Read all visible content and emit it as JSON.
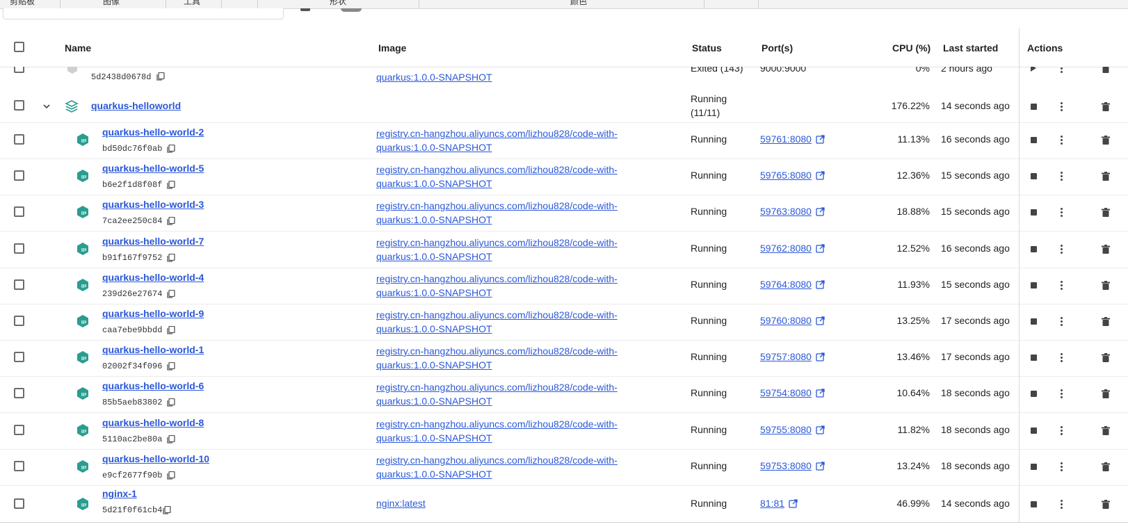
{
  "ribbon": {
    "sections": [
      "剪贴板",
      "图像",
      "工具",
      "形状",
      "颜色"
    ]
  },
  "table": {
    "columns": {
      "name": "Name",
      "image": "Image",
      "status": "Status",
      "ports": "Port(s)",
      "cpu": "CPU (%)",
      "last_started": "Last started",
      "actions": "Actions"
    },
    "partial_row": {
      "id": "5d2438d0678d",
      "image": "quarkus:1.0.0-SNAPSHOT",
      "status": "Exited (143)",
      "ports": "9000:9000",
      "cpu": "0%",
      "last_started": "2 hours ago"
    },
    "group": {
      "name": "quarkus-helloworld",
      "status_line1": "Running",
      "status_line2": "(11/11)",
      "cpu": "176.22%",
      "last_started": "14 seconds ago"
    },
    "containers": [
      {
        "name": "quarkus-hello-world-2",
        "id": "bd50dc76f0ab",
        "image_line1": "registry.cn-hangzhou.aliyuncs.com/lizhou828/code-with-",
        "image_line2": "quarkus:1.0.0-SNAPSHOT",
        "status": "Running",
        "ports": "59761:8080",
        "cpu": "11.13%",
        "last_started": "16 seconds ago"
      },
      {
        "name": "quarkus-hello-world-5",
        "id": "b6e2f1d8f08f",
        "image_line1": "registry.cn-hangzhou.aliyuncs.com/lizhou828/code-with-",
        "image_line2": "quarkus:1.0.0-SNAPSHOT",
        "status": "Running",
        "ports": "59765:8080",
        "cpu": "12.36%",
        "last_started": "15 seconds ago"
      },
      {
        "name": "quarkus-hello-world-3",
        "id": "7ca2ee250c84",
        "image_line1": "registry.cn-hangzhou.aliyuncs.com/lizhou828/code-with-",
        "image_line2": "quarkus:1.0.0-SNAPSHOT",
        "status": "Running",
        "ports": "59763:8080",
        "cpu": "18.88%",
        "last_started": "15 seconds ago"
      },
      {
        "name": "quarkus-hello-world-7",
        "id": "b91f167f9752",
        "image_line1": "registry.cn-hangzhou.aliyuncs.com/lizhou828/code-with-",
        "image_line2": "quarkus:1.0.0-SNAPSHOT",
        "status": "Running",
        "ports": "59762:8080",
        "cpu": "12.52%",
        "last_started": "16 seconds ago"
      },
      {
        "name": "quarkus-hello-world-4",
        "id": "239d26e27674",
        "image_line1": "registry.cn-hangzhou.aliyuncs.com/lizhou828/code-with-",
        "image_line2": "quarkus:1.0.0-SNAPSHOT",
        "status": "Running",
        "ports": "59764:8080",
        "cpu": "11.93%",
        "last_started": "15 seconds ago"
      },
      {
        "name": "quarkus-hello-world-9",
        "id": "caa7ebe9bbdd",
        "image_line1": "registry.cn-hangzhou.aliyuncs.com/lizhou828/code-with-",
        "image_line2": "quarkus:1.0.0-SNAPSHOT",
        "status": "Running",
        "ports": "59760:8080",
        "cpu": "13.25%",
        "last_started": "17 seconds ago"
      },
      {
        "name": "quarkus-hello-world-1",
        "id": "02002f34f096",
        "image_line1": "registry.cn-hangzhou.aliyuncs.com/lizhou828/code-with-",
        "image_line2": "quarkus:1.0.0-SNAPSHOT",
        "status": "Running",
        "ports": "59757:8080",
        "cpu": "13.46%",
        "last_started": "17 seconds ago"
      },
      {
        "name": "quarkus-hello-world-6",
        "id": "85b5aeb83802",
        "image_line1": "registry.cn-hangzhou.aliyuncs.com/lizhou828/code-with-",
        "image_line2": "quarkus:1.0.0-SNAPSHOT",
        "status": "Running",
        "ports": "59754:8080",
        "cpu": "10.64%",
        "last_started": "18 seconds ago"
      },
      {
        "name": "quarkus-hello-world-8",
        "id": "5110ac2be80a",
        "image_line1": "registry.cn-hangzhou.aliyuncs.com/lizhou828/code-with-",
        "image_line2": "quarkus:1.0.0-SNAPSHOT",
        "status": "Running",
        "ports": "59755:8080",
        "cpu": "11.82%",
        "last_started": "18 seconds ago"
      },
      {
        "name": "quarkus-hello-world-10",
        "id": "e9cf2677f90b",
        "image_line1": "registry.cn-hangzhou.aliyuncs.com/lizhou828/code-with-",
        "image_line2": "quarkus:1.0.0-SNAPSHOT",
        "status": "Running",
        "ports": "59753:8080",
        "cpu": "13.24%",
        "last_started": "18 seconds ago"
      }
    ],
    "standalone": {
      "name": "nginx-1",
      "id": "5d21f0f61cb4",
      "image": "nginx:latest",
      "status": "Running",
      "ports": "81:81",
      "cpu": "46.99%",
      "last_started": "14 seconds ago"
    }
  },
  "colors": {
    "accent": "#2b58d8",
    "container_icon": "#2a9d8f"
  }
}
